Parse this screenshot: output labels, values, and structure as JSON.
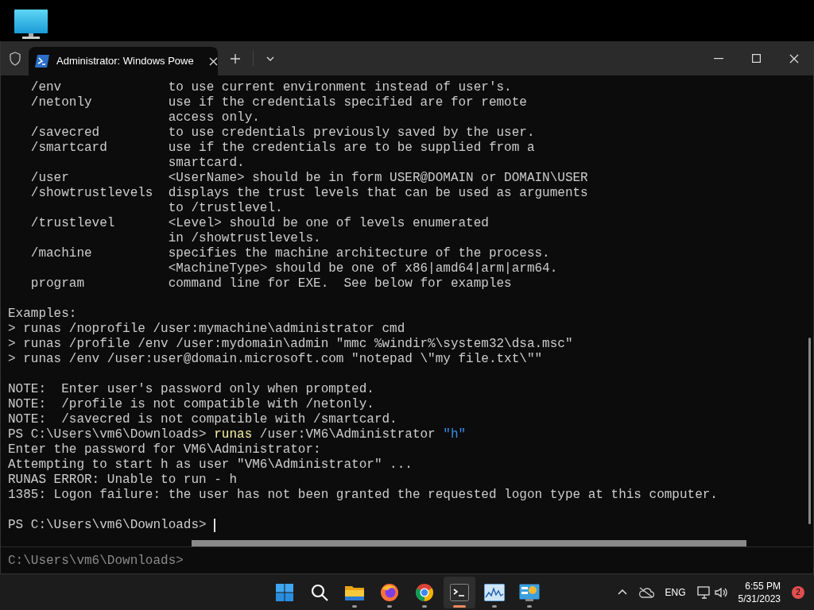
{
  "tab": {
    "title": "Administrator: Windows Powe",
    "selected": true
  },
  "terminal": {
    "lines": [
      {
        "kind": "text",
        "text": "   /env              to use current environment instead of user's."
      },
      {
        "kind": "text",
        "text": "   /netonly          use if the credentials specified are for remote"
      },
      {
        "kind": "text",
        "text": "                     access only."
      },
      {
        "kind": "text",
        "text": "   /savecred         to use credentials previously saved by the user."
      },
      {
        "kind": "text",
        "text": "   /smartcard        use if the credentials are to be supplied from a"
      },
      {
        "kind": "text",
        "text": "                     smartcard."
      },
      {
        "kind": "text",
        "text": "   /user             <UserName> should be in form USER@DOMAIN or DOMAIN\\USER"
      },
      {
        "kind": "text",
        "text": "   /showtrustlevels  displays the trust levels that can be used as arguments"
      },
      {
        "kind": "text",
        "text": "                     to /trustlevel."
      },
      {
        "kind": "text",
        "text": "   /trustlevel       <Level> should be one of levels enumerated"
      },
      {
        "kind": "text",
        "text": "                     in /showtrustlevels."
      },
      {
        "kind": "text",
        "text": "   /machine          specifies the machine architecture of the process."
      },
      {
        "kind": "text",
        "text": "                     <MachineType> should be one of x86|amd64|arm|arm64."
      },
      {
        "kind": "text",
        "text": "   program           command line for EXE.  See below for examples"
      },
      {
        "kind": "blank"
      },
      {
        "kind": "text",
        "text": "Examples:"
      },
      {
        "kind": "text",
        "text": "> runas /noprofile /user:mymachine\\administrator cmd"
      },
      {
        "kind": "text",
        "text": "> runas /profile /env /user:mydomain\\admin \"mmc %windir%\\system32\\dsa.msc\""
      },
      {
        "kind": "text",
        "text": "> runas /env /user:user@domain.microsoft.com \"notepad \\\"my file.txt\\\"\""
      },
      {
        "kind": "blank"
      },
      {
        "kind": "text",
        "text": "NOTE:  Enter user's password only when prompted."
      },
      {
        "kind": "text",
        "text": "NOTE:  /profile is not compatible with /netonly."
      },
      {
        "kind": "text",
        "text": "NOTE:  /savecred is not compatible with /smartcard."
      },
      {
        "kind": "command",
        "prompt": "PS C:\\Users\\vm6\\Downloads>",
        "command": "runas",
        "argument": "/user:VM6\\Administrator",
        "string": "\"h\""
      },
      {
        "kind": "text",
        "text": "Enter the password for VM6\\Administrator:"
      },
      {
        "kind": "text",
        "text": "Attempting to start h as user \"VM6\\Administrator\" ..."
      },
      {
        "kind": "text",
        "text": "RUNAS ERROR: Unable to run - h"
      },
      {
        "kind": "text",
        "text": "1385: Logon failure: the user has not been granted the requested logon type at this computer."
      },
      {
        "kind": "blank"
      },
      {
        "kind": "prompt",
        "prompt": "PS C:\\Users\\vm6\\Downloads>"
      }
    ],
    "suggestion": "C:\\Users\\vm6\\Downloads>"
  },
  "taskbar": {
    "apps": [
      {
        "kind": "start",
        "running": false,
        "selected": false
      },
      {
        "kind": "search",
        "running": false,
        "selected": false
      },
      {
        "kind": "folder",
        "running": true,
        "selected": false
      },
      {
        "kind": "firefox",
        "running": true,
        "selected": false
      },
      {
        "kind": "chrome",
        "running": true,
        "selected": false
      },
      {
        "kind": "terminal",
        "running": true,
        "selected": true
      },
      {
        "kind": "monitor",
        "running": true,
        "selected": false
      },
      {
        "kind": "control",
        "running": true,
        "selected": false
      }
    ],
    "language": "ENG",
    "time": "6:55 PM",
    "date": "5/31/2023",
    "notifications": "2"
  }
}
